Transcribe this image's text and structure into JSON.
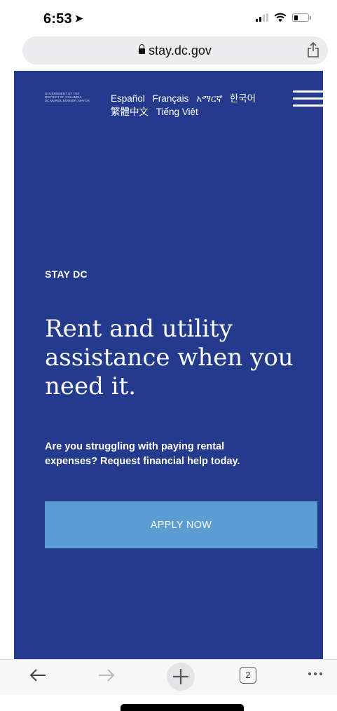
{
  "status_bar": {
    "time": "6:53",
    "location_arrow": "➤"
  },
  "browser": {
    "url": "stay.dc.gov",
    "tabs_count": "2"
  },
  "site": {
    "logo_lines": [
      "GOVERNMENT OF THE",
      "DISTRICT OF COLUMBIA",
      "DC MURIEL BOWSER, MAYOR"
    ],
    "languages": [
      "Español",
      "Français",
      "አማርኛ",
      "한국어",
      "繁體中文",
      "Tiếng Việt"
    ],
    "eyebrow": "STAY DC",
    "headline": "Rent and utility assistance when you need it.",
    "subtext": "Are you struggling with paying rental expenses? Request financial help today.",
    "apply_label": "APPLY NOW"
  },
  "colors": {
    "page_background": "#233a8d",
    "apply_button": "#5b9cd3"
  }
}
